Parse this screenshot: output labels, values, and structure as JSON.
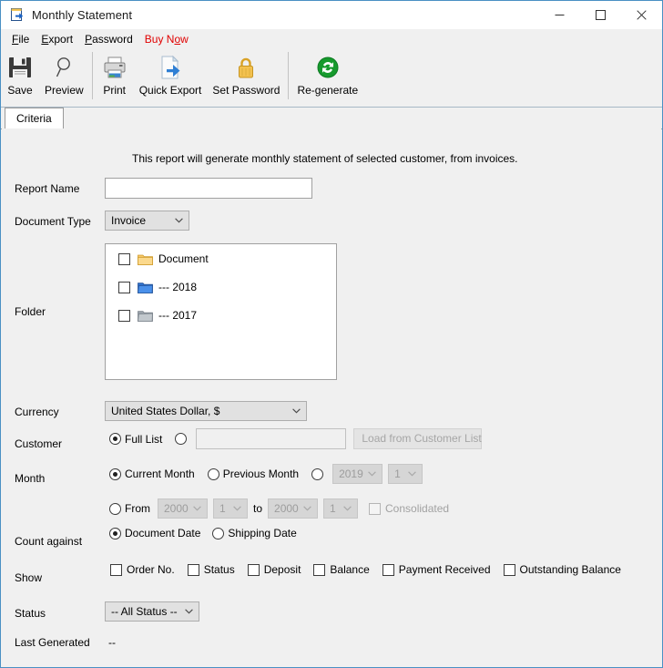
{
  "window": {
    "title": "Monthly Statement",
    "title_icon": "export-document-icon",
    "controls": {
      "minimize": "minimize-icon",
      "maximize": "maximize-icon",
      "close": "close-icon"
    }
  },
  "menubar": {
    "items": [
      {
        "label": "File",
        "accel_index": 0,
        "accent": false
      },
      {
        "label": "Export",
        "accel_index": 0,
        "accent": false
      },
      {
        "label": "Password",
        "accel_index": 0,
        "accent": false
      },
      {
        "label": "Buy Now",
        "accel_index": 5,
        "accent": true
      }
    ]
  },
  "toolbar": {
    "buttons": [
      {
        "label": "Save",
        "icon": "floppy-disk-icon"
      },
      {
        "label": "Preview",
        "icon": "magnifier-icon"
      },
      {
        "label": "Print",
        "icon": "printer-icon"
      },
      {
        "label": "Quick Export",
        "icon": "export-arrow-icon"
      },
      {
        "label": "Set Password",
        "icon": "padlock-icon"
      },
      {
        "label": "Re-generate",
        "icon": "refresh-circle-icon"
      }
    ]
  },
  "tabs": [
    {
      "label": "Criteria",
      "active": true
    }
  ],
  "form": {
    "description": "This report will generate monthly statement of selected customer, from invoices.",
    "labels": {
      "report_name": "Report Name",
      "document_type": "Document Type",
      "folder": "Folder",
      "currency": "Currency",
      "customer": "Customer",
      "month": "Month",
      "count_against": "Count against",
      "show": "Show",
      "status": "Status",
      "last_generated": "Last Generated"
    },
    "report_name": {
      "value": "",
      "placeholder": ""
    },
    "document_type": {
      "value": "Invoice"
    },
    "folder_tree": [
      {
        "label": "Document",
        "checked": false,
        "icon": "folder-yellow-icon"
      },
      {
        "label": "--- 2018",
        "checked": false,
        "icon": "folder-blue-icon"
      },
      {
        "label": "--- 2017",
        "checked": false,
        "icon": "folder-gray-icon"
      }
    ],
    "currency": {
      "value": "United States Dollar, $"
    },
    "customer": {
      "full_list_label": "Full List",
      "full_list_selected": true,
      "specific_selected": false,
      "input_value": "",
      "load_button_label": "Load from Customer List",
      "load_button_disabled": true
    },
    "month": {
      "current_label": "Current Month",
      "current_selected": true,
      "previous_label": "Previous Month",
      "previous_selected": false,
      "specific_selected": false,
      "specific_year": "2019",
      "specific_month": "1",
      "from_label": "From",
      "from_selected": false,
      "from_year": "2000",
      "from_month": "1",
      "to_label": "to",
      "to_year": "2000",
      "to_month": "1",
      "consolidated_label": "Consolidated",
      "consolidated_checked": false,
      "consolidated_disabled": true
    },
    "count_against": {
      "document_date_label": "Document Date",
      "document_date_selected": true,
      "shipping_date_label": "Shipping Date",
      "shipping_date_selected": false
    },
    "show_options": [
      {
        "label": "Order No.",
        "checked": false
      },
      {
        "label": "Status",
        "checked": false
      },
      {
        "label": "Deposit",
        "checked": false
      },
      {
        "label": "Balance",
        "checked": false
      },
      {
        "label": "Payment Received",
        "checked": false
      },
      {
        "label": "Outstanding Balance",
        "checked": false
      }
    ],
    "status": {
      "value": "-- All Status --"
    },
    "last_generated": {
      "value": "--"
    }
  },
  "colors": {
    "window_border": "#4a90c4",
    "panel_bg": "#f0f0f0",
    "accent_link": "#e00000",
    "folder_yellow": "#f0b64c",
    "folder_blue": "#3f7fd6",
    "folder_gray": "#9aa3ab",
    "regenerate_green": "#1c8a2e"
  }
}
